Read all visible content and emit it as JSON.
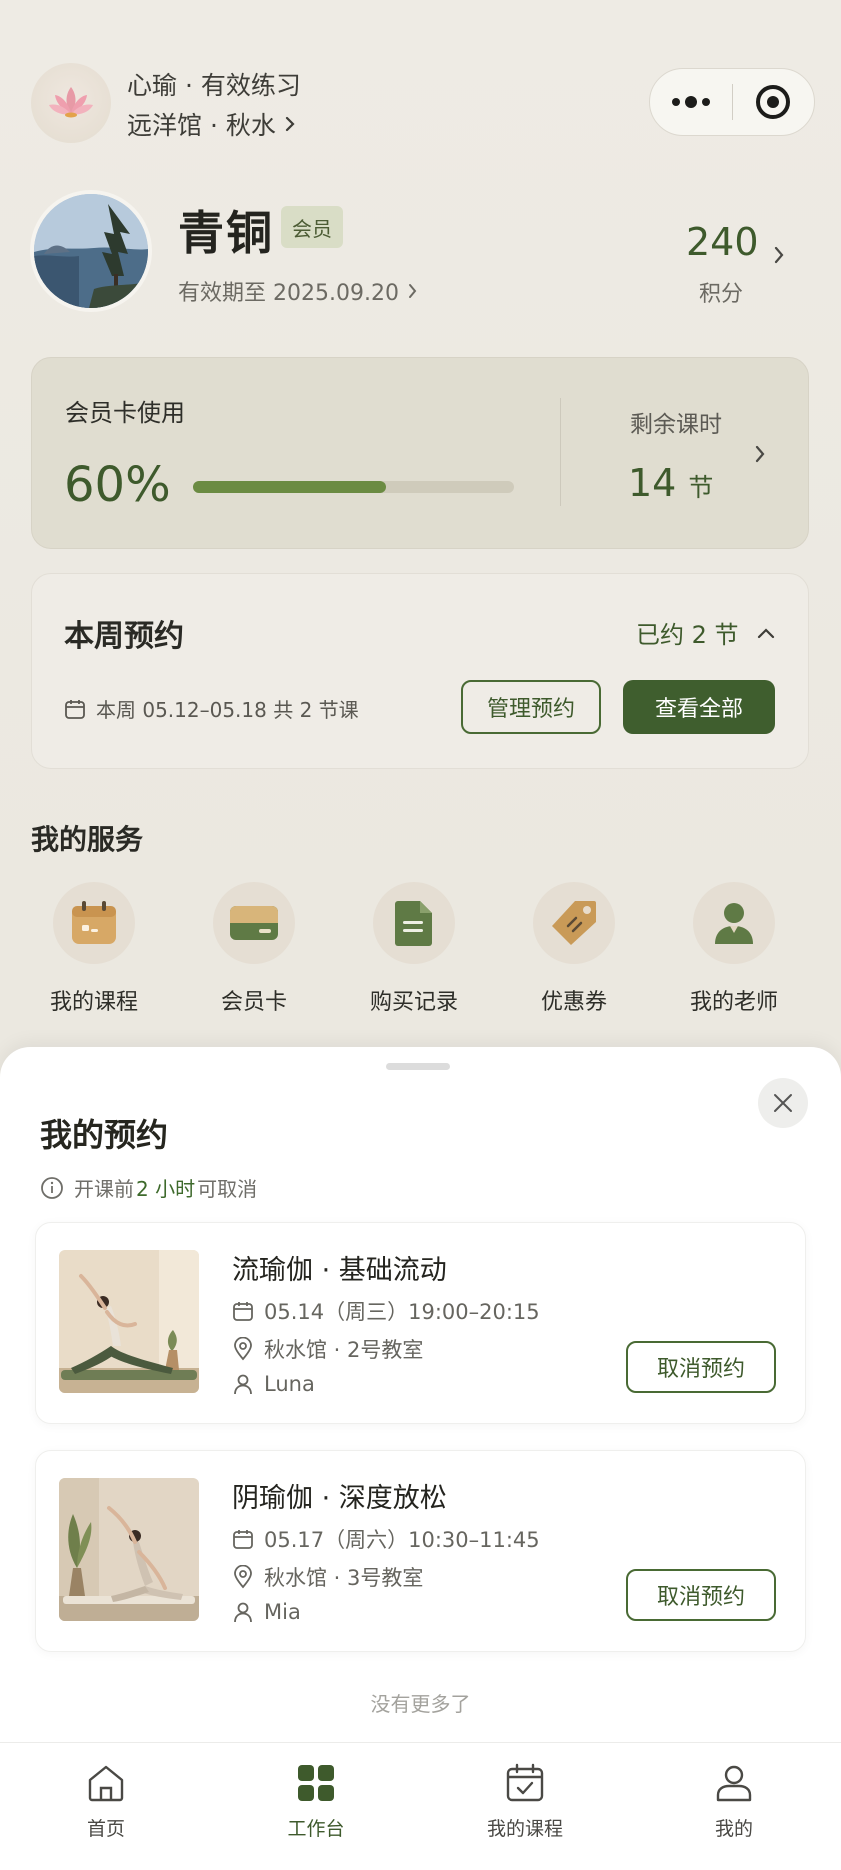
{
  "header": {
    "brand": "心瑜 · 有效练习",
    "venue": "远洋馆 · 秋水"
  },
  "profile": {
    "name": "青铜",
    "badge": "会员",
    "expiry": "有效期至 2025.09.20",
    "points": "240",
    "points_label": "积分"
  },
  "membership_card": {
    "title": "会员卡使用",
    "usage_percent_text": "60%",
    "usage_fraction": 0.6,
    "remaining_label": "剩余课时",
    "remaining_value": "14",
    "remaining_unit": "节"
  },
  "week": {
    "title": "本周预约",
    "booked": "已约 2 节",
    "range": "本周 05.12–05.18 共 2 节课",
    "manage_label": "管理预约",
    "view_all_label": "查看全部"
  },
  "services": {
    "title": "我的服务",
    "items": [
      {
        "label": "我的课程",
        "icon": "calendar-icon"
      },
      {
        "label": "会员卡",
        "icon": "card-icon"
      },
      {
        "label": "购买记录",
        "icon": "document-icon"
      },
      {
        "label": "优惠券",
        "icon": "coupon-tag-icon"
      },
      {
        "label": "我的老师",
        "icon": "teacher-icon"
      }
    ]
  },
  "sheet": {
    "title": "我的预约",
    "notice_prefix": "开课前",
    "notice_highlight": "2 小时",
    "notice_suffix": "可取消",
    "bookings": [
      {
        "title": "流瑜伽 · 基础流动",
        "time": "05.14（周三）19:00–20:15",
        "location": "秋水馆 · 2号教室",
        "teacher": "Luna",
        "cancel_label": "取消预约"
      },
      {
        "title": "阴瑜伽 · 深度放松",
        "time": "05.17（周六）10:30–11:45",
        "location": "秋水馆 · 3号教室",
        "teacher": "Mia",
        "cancel_label": "取消预约"
      }
    ],
    "no_more": "没有更多了"
  },
  "tabbar": {
    "items": [
      {
        "label": "首页",
        "icon": "home-icon"
      },
      {
        "label": "工作台",
        "icon": "grid-icon"
      },
      {
        "label": "我的课程",
        "icon": "calendar-check-icon"
      },
      {
        "label": "我的",
        "icon": "user-icon"
      }
    ],
    "active_index": 1
  },
  "colors": {
    "accent": "#3e5a2c",
    "accent_light": "#6b8b42",
    "background": "#ece9e2"
  }
}
